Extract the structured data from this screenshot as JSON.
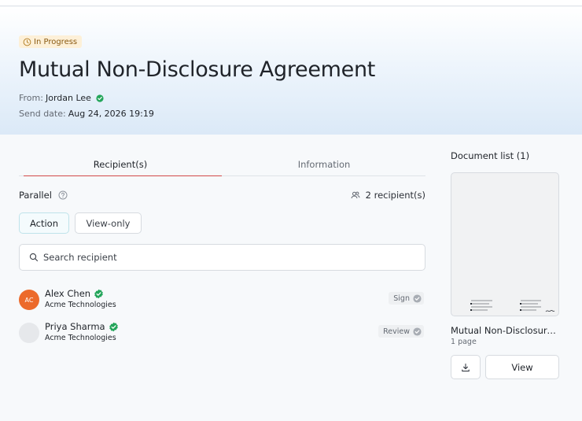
{
  "status_badge": "In Progress",
  "document": {
    "title": "Mutual Non-Disclosure Agreement",
    "from_label": "From:",
    "from_value": "Jordan Lee",
    "send_date_label": "Send date:",
    "send_date_value": "Aug 24, 2026 19:19"
  },
  "tabs": [
    {
      "label": "Recipient(s)",
      "active": true
    },
    {
      "label": "Information",
      "active": false
    }
  ],
  "signing_mode": "Parallel",
  "recipient_count": "2 recipient(s)",
  "filters": {
    "action": "Action",
    "view_only": "View-only"
  },
  "search": {
    "placeholder": "Search recipient",
    "value": ""
  },
  "recipients": [
    {
      "initials": "AC",
      "name": "Alex Chen",
      "company": "Acme Technologies",
      "role": "Sign",
      "avatar_color": "#ec6a2b"
    },
    {
      "initials": "",
      "name": "Priya Sharma",
      "company": "Acme Technologies",
      "role": "Review",
      "avatar_color": "#e6e8eb"
    }
  ],
  "document_list": {
    "heading": "Document list (1)",
    "name": "Mutual Non-Disclosure Agreement",
    "pages": "1 page",
    "view_label": "View"
  },
  "colors": {
    "accent_tab": "#d24a4a",
    "verified": "#23a55a",
    "badge_bg": "#fdf0d8"
  }
}
